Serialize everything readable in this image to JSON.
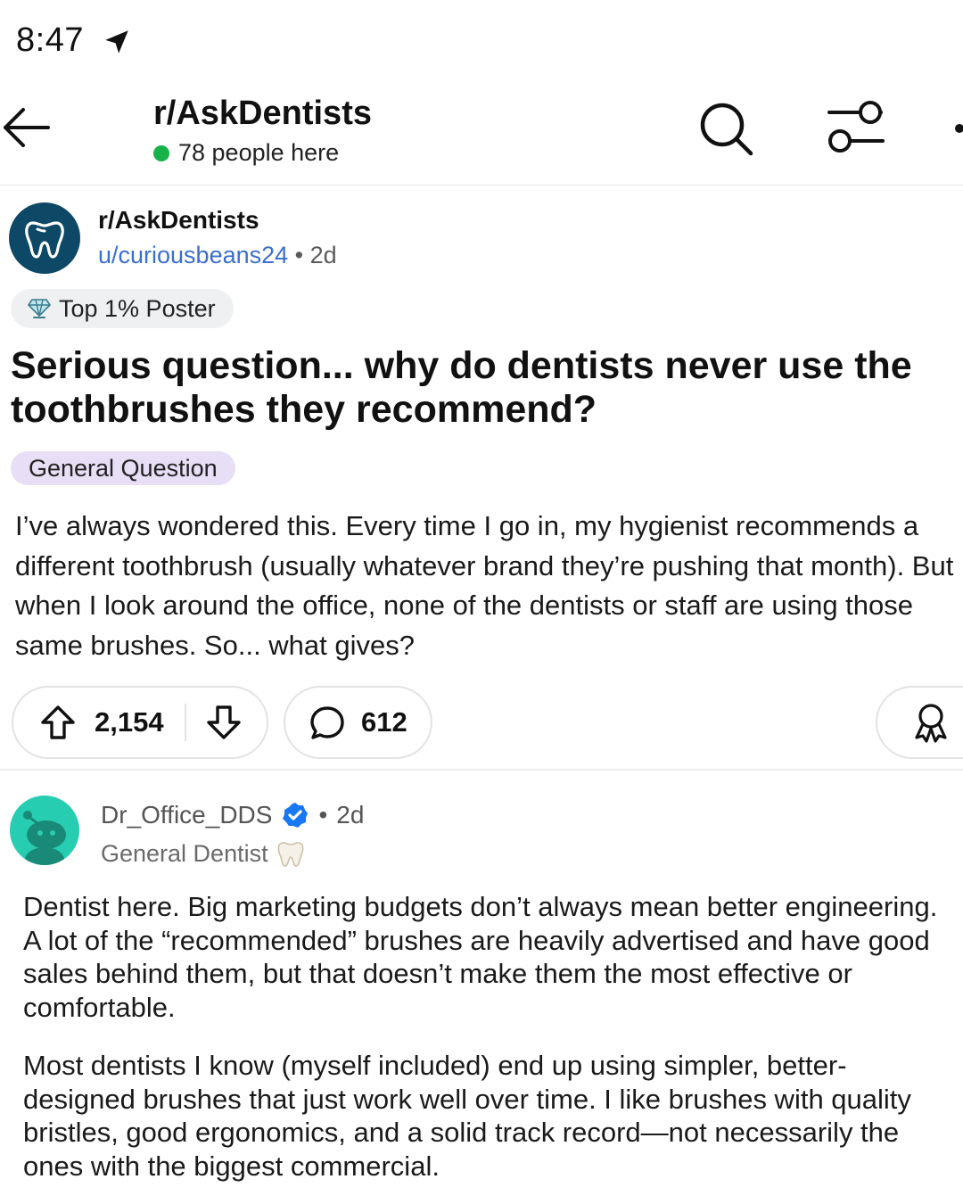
{
  "status_bar": {
    "time": "8:47",
    "location_icon": "location-arrow-icon"
  },
  "header": {
    "back_icon": "back-arrow-icon",
    "title": "r/AskDentists",
    "online_text": "78 people here",
    "online_color": "#17b24a",
    "search_icon": "search-icon",
    "filter_icon": "filter-icon",
    "more_icon": "more-icon"
  },
  "post": {
    "subreddit": "r/AskDentists",
    "avatar_icon": "tooth-icon",
    "author": "u/curiousbeans24",
    "separator": "•",
    "age": "2d",
    "flair": {
      "icon": "diamond-trophy-icon",
      "label": "Top 1% Poster"
    },
    "title": "Serious question... why do dentists never use the toothbrushes they recommend?",
    "tag": "General Question",
    "body": "I’ve always wondered this. Every time I go in, my hygienist recommends a different toothbrush (usually whatever brand they’re pushing that month). But when I look around the office, none of the dentists or staff are using those same brushes. So... what gives?",
    "upvotes": "2,154",
    "comments": "612",
    "actions": {
      "upvote_icon": "upvote-arrow-icon",
      "downvote_icon": "downvote-arrow-icon",
      "comment_icon": "comment-bubble-icon",
      "award_icon": "award-icon"
    }
  },
  "comment": {
    "author": "Dr_Office_DDS",
    "verified_icon": "verified-badge-icon",
    "separator": "•",
    "age": "2d",
    "flair": "General Dentist",
    "flair_icon": "tooth-icon",
    "paragraphs": [
      "Dentist here. Big marketing budgets don’t always mean better engineering. A lot of the “recommended” brushes are heavily advertised and have good sales behind them, but that doesn’t make them the most effective or comfortable.",
      "Most dentists I know (myself included) end up using simpler, better-designed brushes that just work well over time. I like brushes with quality bristles, good ergonomics, and a solid track record—not necessarily the ones with the biggest commercial."
    ]
  },
  "colors": {
    "link_blue": "#3a6fcb",
    "tag_purple": "#e8def6",
    "subreddit_avatar": "#0d4866",
    "comment_avatar": "#27cdb0",
    "verified_blue": "#1877f2"
  }
}
